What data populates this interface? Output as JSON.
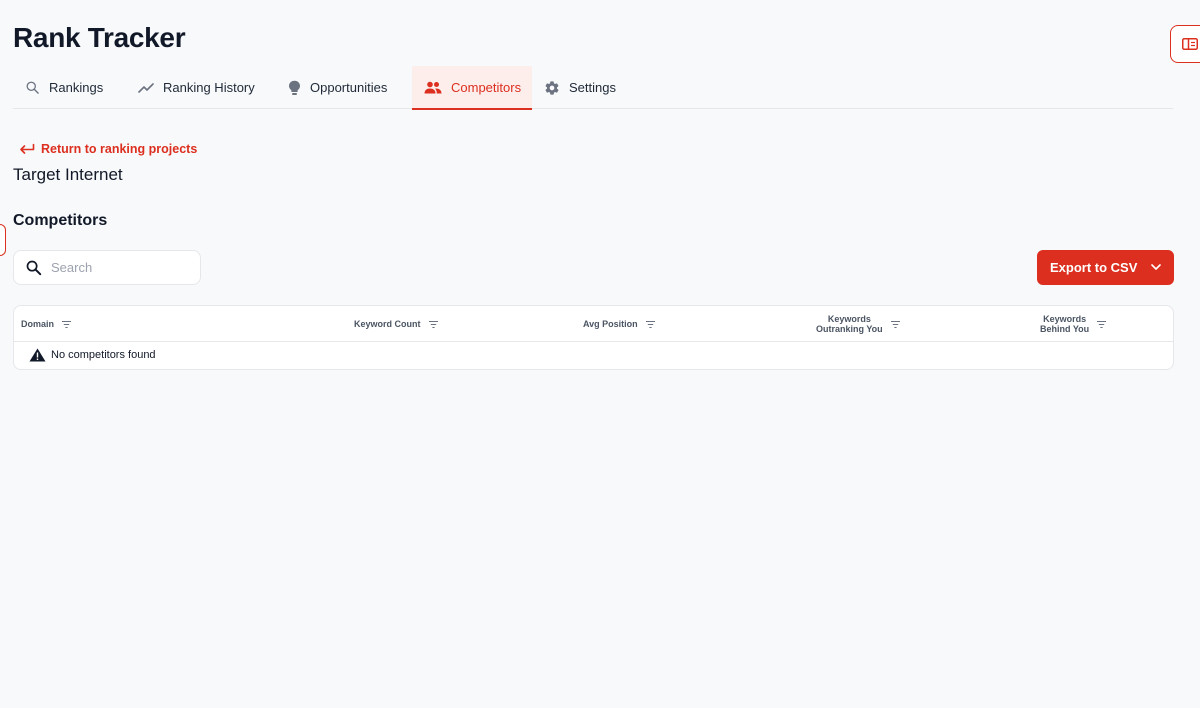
{
  "app": {
    "title": "Rank Tracker"
  },
  "tabs": [
    {
      "label": "Rankings",
      "icon": "search-icon"
    },
    {
      "label": "Ranking History",
      "icon": "trend-icon"
    },
    {
      "label": "Opportunities",
      "icon": "lightbulb-icon"
    },
    {
      "label": "Competitors",
      "icon": "people-icon",
      "active": true
    },
    {
      "label": "Settings",
      "icon": "gear-icon"
    }
  ],
  "return_link": {
    "label": "Return to ranking projects"
  },
  "project": {
    "name": "Target Internet"
  },
  "section": {
    "title": "Competitors"
  },
  "search": {
    "placeholder": "Search",
    "value": ""
  },
  "export": {
    "label": "Export to CSV"
  },
  "table": {
    "columns": [
      {
        "line1": "Domain",
        "line2": ""
      },
      {
        "line1": "Keyword Count",
        "line2": ""
      },
      {
        "line1": "Avg Position",
        "line2": ""
      },
      {
        "line1": "Keywords",
        "line2": "Outranking You"
      },
      {
        "line1": "Keywords",
        "line2": "Behind You"
      }
    ],
    "empty_message": "No competitors found"
  },
  "colors": {
    "accent": "#dc2f1f",
    "active_tab_bg": "#fdeeec",
    "background": "#f8f9fb"
  }
}
